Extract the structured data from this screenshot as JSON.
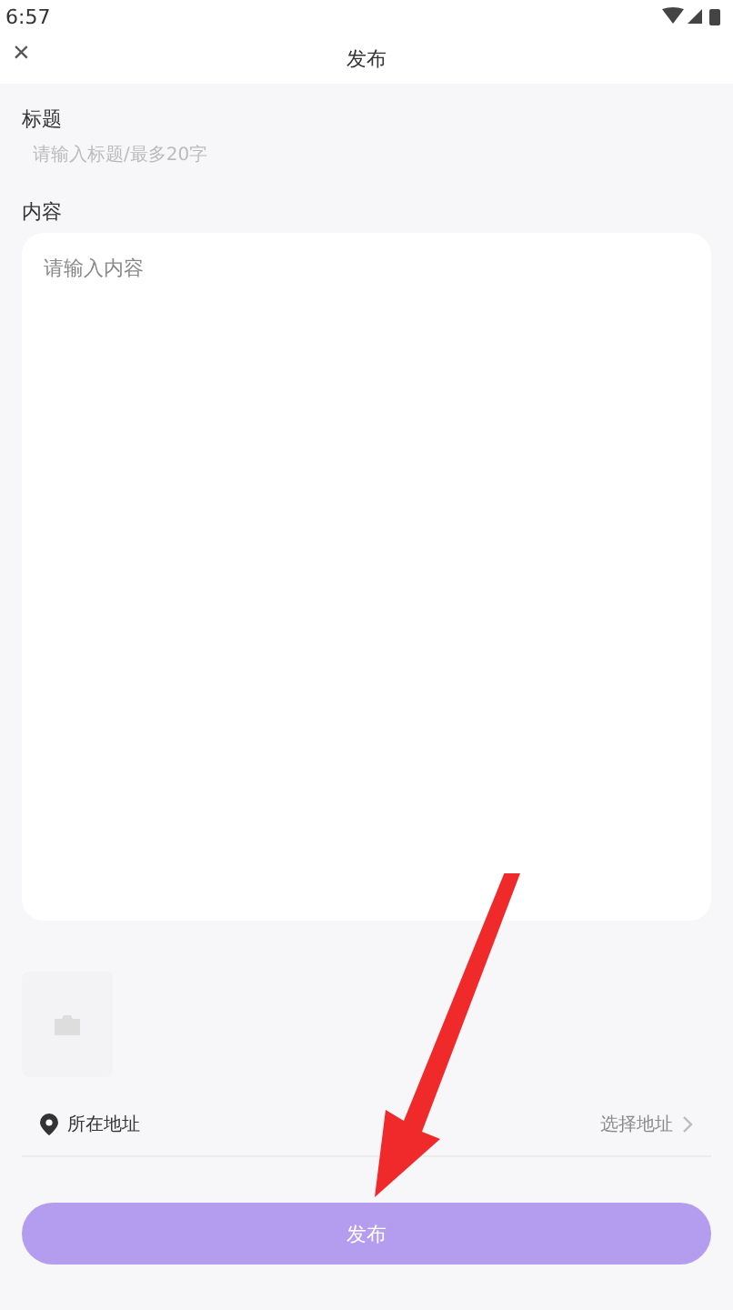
{
  "status_bar": {
    "time": "6:57"
  },
  "header": {
    "close": "×",
    "title": "发布"
  },
  "title_field": {
    "label": "标题",
    "placeholder": "请输入标题/最多20字"
  },
  "content_field": {
    "label": "内容",
    "placeholder": "请输入内容"
  },
  "location": {
    "label": "所在地址",
    "action": "选择地址"
  },
  "submit_button": "发布"
}
